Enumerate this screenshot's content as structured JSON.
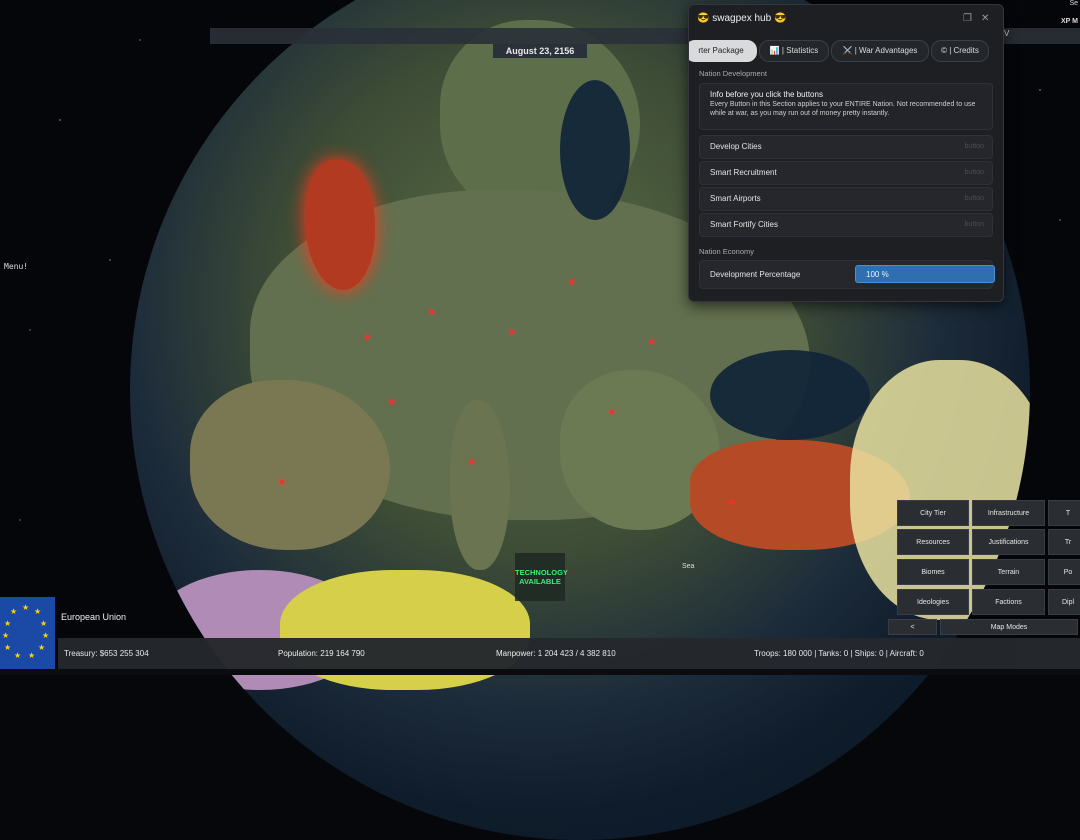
{
  "date": "August 23, 2156",
  "top_right": {
    "line1": "Se",
    "line2": "XP M",
    "v": "V"
  },
  "menu_label": "Menu!",
  "hub": {
    "title": "😎 swagpex hub 😎",
    "tabs": [
      "rter Package",
      "📊 | Statistics",
      "⚔️ | War Advantages",
      "© | Credits"
    ],
    "nation_development": "Nation Development",
    "info_title": "Info before you click the buttons",
    "info_desc": "Every Button in this Section applies to your ENTIRE Nation. Not recommended to use while at war, as you may run out of money pretty instantly.",
    "buttons": [
      {
        "label": "Develop Cities",
        "hint": "button"
      },
      {
        "label": "Smart Recruitment",
        "hint": "button"
      },
      {
        "label": "Smart Airports",
        "hint": "button"
      },
      {
        "label": "Smart Fortify Cities",
        "hint": "button"
      }
    ],
    "nation_economy": "Nation Economy",
    "dev_label": "Development Percentage",
    "dev_value": "100 %"
  },
  "map": {
    "tech_label": "TECHNOLOGY AVAILABLE",
    "sea_label": "Sea"
  },
  "map_modes": {
    "buttons": [
      "City Tier",
      "Infrastructure",
      "T",
      "Resources",
      "Justifications",
      "Tr",
      "Biomes",
      "Terrain",
      "Po",
      "Ideologies",
      "Factions",
      "Dipl"
    ],
    "back": "<",
    "title": "Map Modes"
  },
  "nation": {
    "name": "European Union",
    "treasury": "Treasury:  $653 255 304",
    "population": "Population: 219 164 790",
    "manpower": "Manpower:  1 204 423  /  4 382 810",
    "military": "Troops: 180 000  |  Tanks: 0  |  Ships: 0  |  Aircraft: 0"
  },
  "colors": {
    "accent": "#2f6fb0",
    "panel": "#1d1f23",
    "eu_blue": "#1b4aa6",
    "tech_green": "#3df06c"
  }
}
